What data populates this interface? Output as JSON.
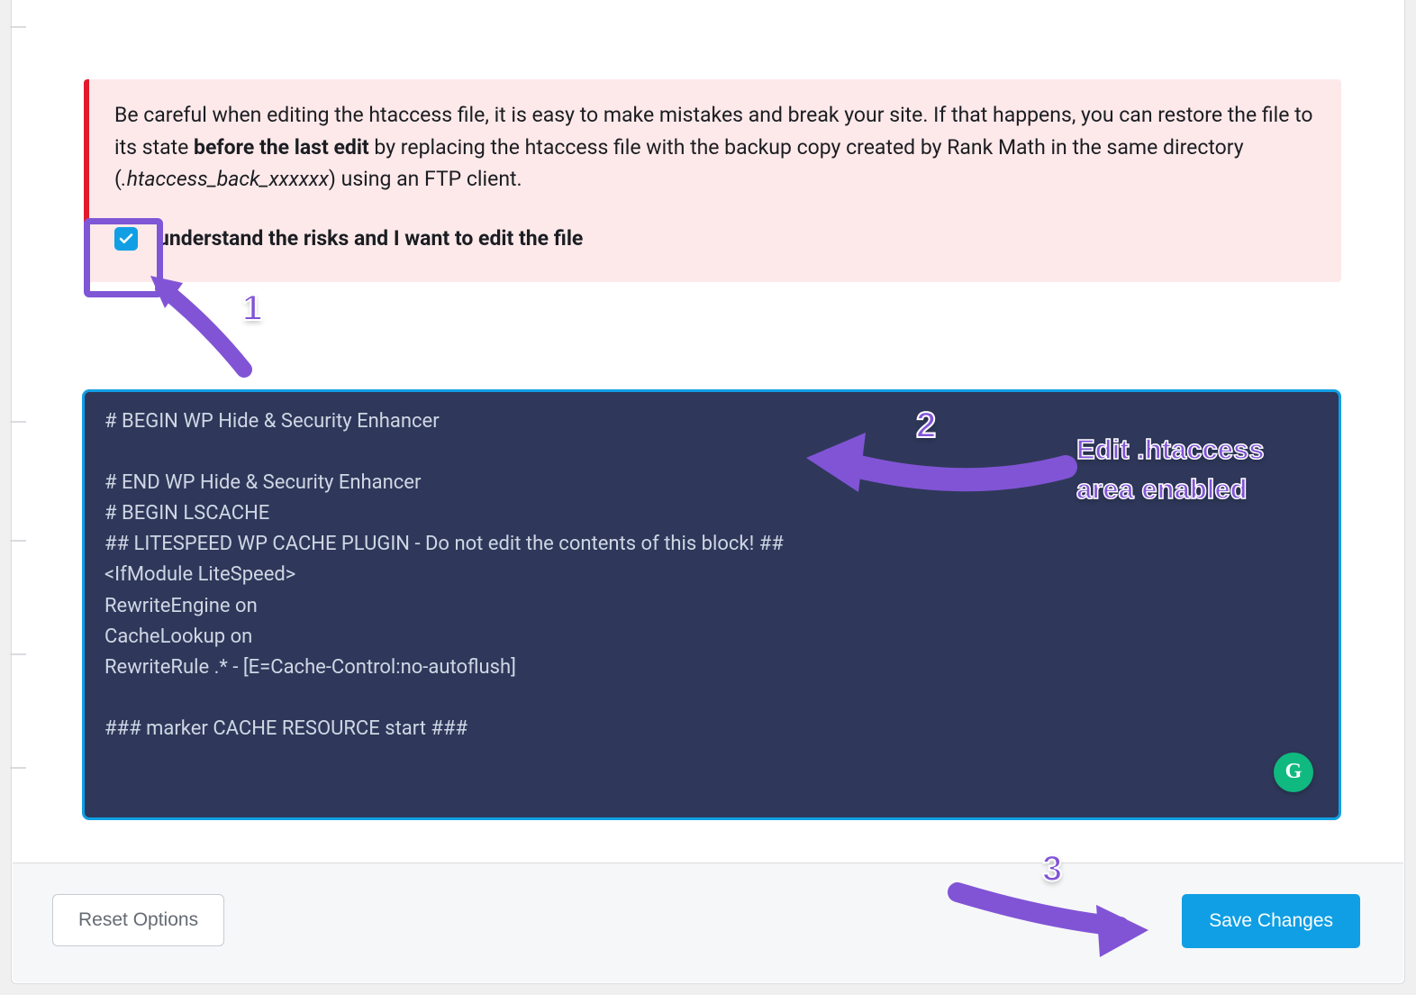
{
  "colors": {
    "accent": "#109fe4",
    "annotation": "#8154d6",
    "warning_bg": "#fde9ea",
    "warning_border": "#e21b2c",
    "editor_bg": "#2f385a"
  },
  "warning": {
    "text_before": "Be careful when editing the htaccess file, it is easy to make mistakes and break your site. If that happens, you can restore the file to its state ",
    "text_bold": "before the last edit",
    "text_mid": " by replacing the htaccess file with the backup copy created by Rank Math in the same directory (",
    "text_italic": ".htaccess_back_xxxxxx",
    "text_after": ") using an FTP client."
  },
  "consent": {
    "checked": true,
    "label": "understand the risks and I want to edit the file"
  },
  "editor": {
    "content": "# BEGIN WP Hide & Security Enhancer\n\n# END WP Hide & Security Enhancer\n# BEGIN LSCACHE\n## LITESPEED WP CACHE PLUGIN - Do not edit the contents of this block! ##\n<IfModule LiteSpeed>\nRewriteEngine on\nCacheLookup on\nRewriteRule .* - [E=Cache-Control:no-autoflush]\n\n### marker CACHE RESOURCE start ###",
    "grammarly_badge": "G"
  },
  "footer": {
    "reset_label": "Reset Options",
    "save_label": "Save Changes"
  },
  "annotations": {
    "n1": "1",
    "n2": "2",
    "n3": "3",
    "text_line1": "Edit .htaccess",
    "text_line2": "area enabled"
  }
}
